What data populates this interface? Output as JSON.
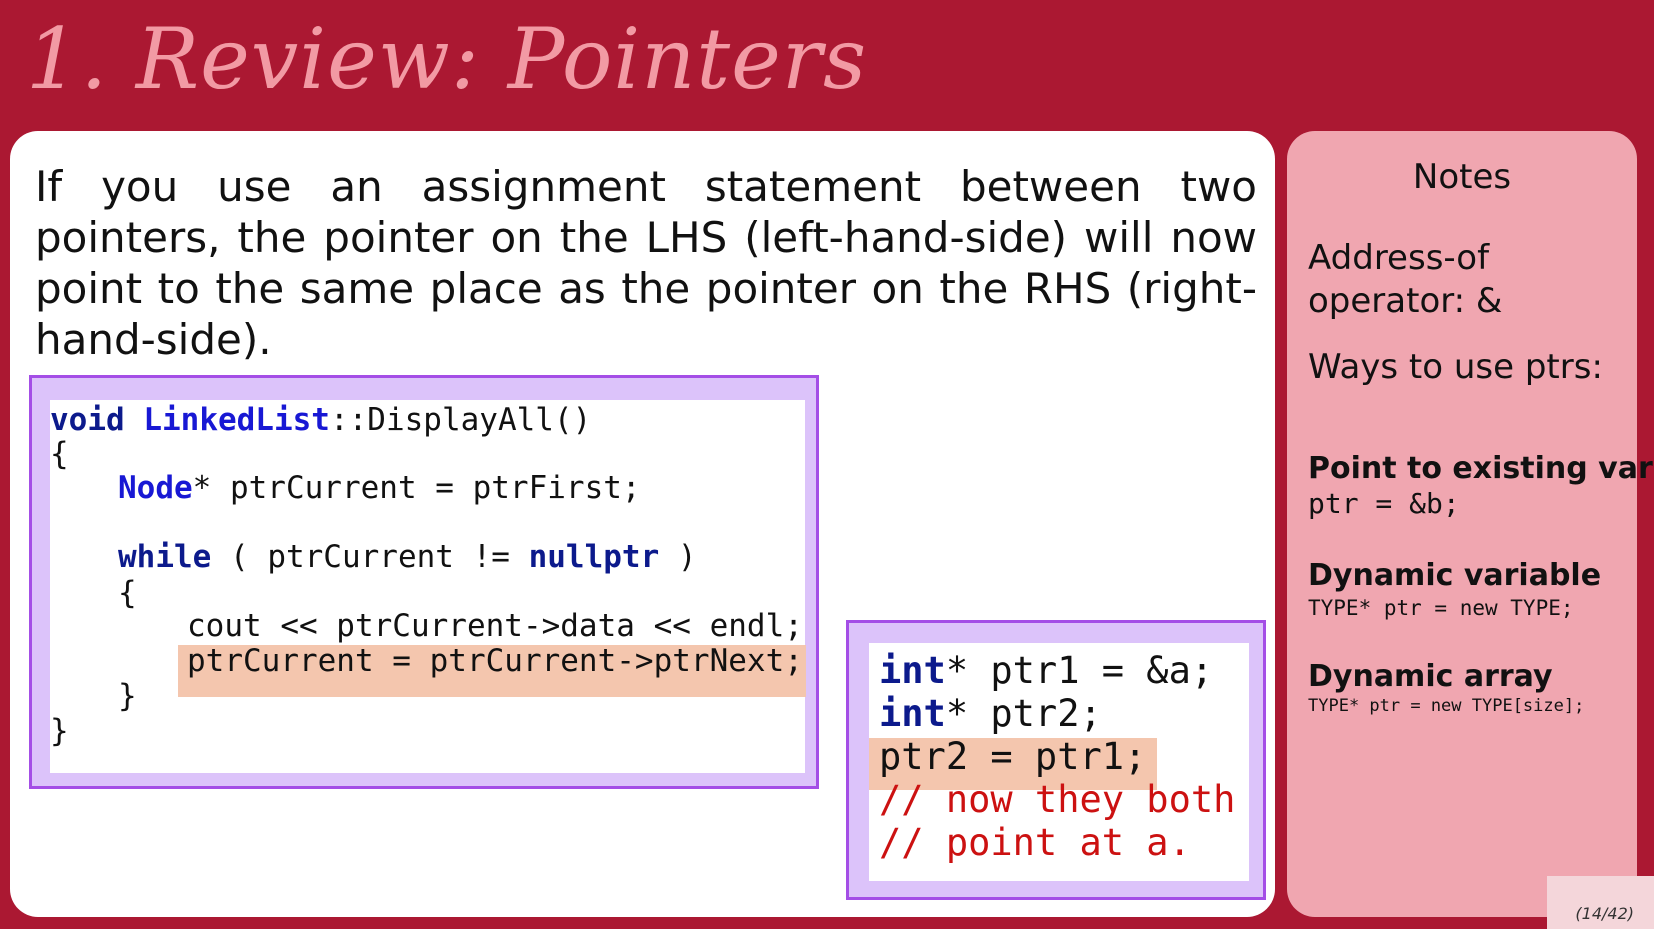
{
  "slide": {
    "title": "1. Review: Pointers",
    "page_number": "(14/42)"
  },
  "main": {
    "paragraph": "If you use an assignment statement between two pointers, the pointer on the LHS (left-hand-side) will now point to the same place as the pointer on the RHS (right-hand-side)."
  },
  "code_example_1": {
    "line1_kw": "void",
    "line1_cls": "LinkedList",
    "line1_rest": "::DisplayAll()",
    "line2": "{",
    "line3_ty": "Node",
    "line3_rest": "* ptrCurrent = ptrFirst;",
    "line5_kw": "while",
    "line5_mid": " ( ptrCurrent != ",
    "line5_kw2": "nullptr",
    "line5_end": " )",
    "line6": "{",
    "line7": "cout << ptrCurrent->data << endl;",
    "line8": "ptrCurrent = ptrCurrent->ptrNext;",
    "line9": "}",
    "line10": "}"
  },
  "code_example_2": {
    "line1_kw": "int",
    "line1_rest": "* ptr1 = &a;",
    "line2_kw": "int",
    "line2_rest": "* ptr2;",
    "line3": "ptr2 = ptr1;",
    "line4": "// now they both",
    "line5": "// point at a."
  },
  "notes": {
    "title": "Notes",
    "address_of": "Address-of operator: &",
    "ways": "Ways to use ptrs:",
    "existing_heading": "Point to existing var",
    "existing_code": "ptr = &b;",
    "dynamic_var_heading": "Dynamic variable",
    "dynamic_var_code": "TYPE* ptr = new TYPE;",
    "dynamic_arr_heading": "Dynamic array",
    "dynamic_arr_code": "TYPE* ptr = new TYPE[size];"
  }
}
